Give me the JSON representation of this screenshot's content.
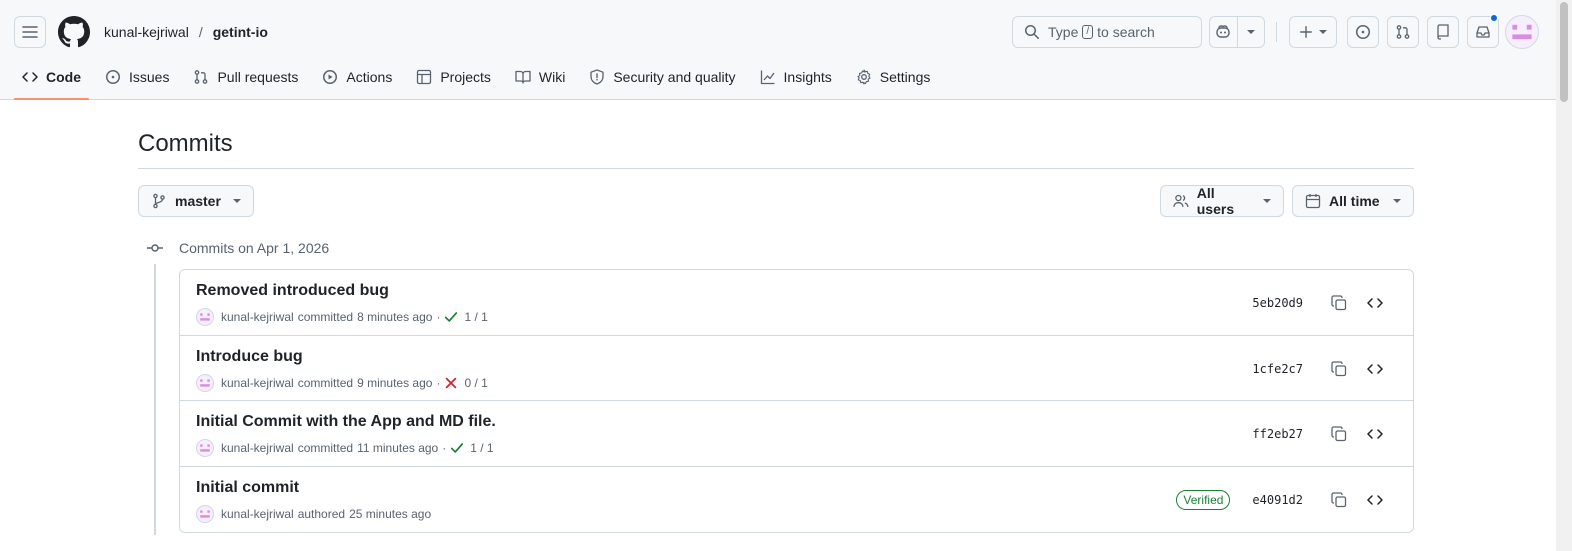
{
  "breadcrumb": {
    "owner": "kunal-kejriwal",
    "separator": "/",
    "repo": "getint-io"
  },
  "search": {
    "prefix": "Type",
    "key": "/",
    "suffix": "to search"
  },
  "nav_tabs": [
    {
      "label": "Code",
      "icon": "code-icon",
      "active": true
    },
    {
      "label": "Issues",
      "icon": "issue-icon"
    },
    {
      "label": "Pull requests",
      "icon": "pull-request-icon"
    },
    {
      "label": "Actions",
      "icon": "play-icon"
    },
    {
      "label": "Projects",
      "icon": "table-icon"
    },
    {
      "label": "Wiki",
      "icon": "book-icon"
    },
    {
      "label": "Security and quality",
      "icon": "shield-icon"
    },
    {
      "label": "Insights",
      "icon": "graph-icon"
    },
    {
      "label": "Settings",
      "icon": "gear-icon"
    }
  ],
  "page": {
    "title": "Commits"
  },
  "filters": {
    "branch": "master",
    "users": "All users",
    "time": "All time"
  },
  "group": {
    "heading": "Commits on Apr 1, 2026"
  },
  "commits": [
    {
      "message": "Removed introduced bug",
      "author": "kunal-kejriwal",
      "verb": "committed",
      "time": "8 minutes ago",
      "status": "success",
      "checks": "1 / 1",
      "sha": "5eb20d9",
      "verified": ""
    },
    {
      "message": "Introduce bug",
      "author": "kunal-kejriwal",
      "verb": "committed",
      "time": "9 minutes ago",
      "status": "failure",
      "checks": "0 / 1",
      "sha": "1cfe2c7",
      "verified": ""
    },
    {
      "message": "Initial Commit with the App and MD file.",
      "author": "kunal-kejriwal",
      "verb": "committed",
      "time": "11 minutes ago",
      "status": "success",
      "checks": "1 / 1",
      "sha": "ff2eb27",
      "verified": ""
    },
    {
      "message": "Initial commit",
      "author": "kunal-kejriwal",
      "verb": "authored",
      "time": "25 minutes ago",
      "status": "none",
      "checks": "",
      "sha": "e4091d2",
      "verified": "Verified"
    }
  ],
  "colors": {
    "accent_underline": "#fd8c73",
    "success": "#1a7f37",
    "failure": "#d1242f",
    "notification_dot": "#0969da"
  }
}
